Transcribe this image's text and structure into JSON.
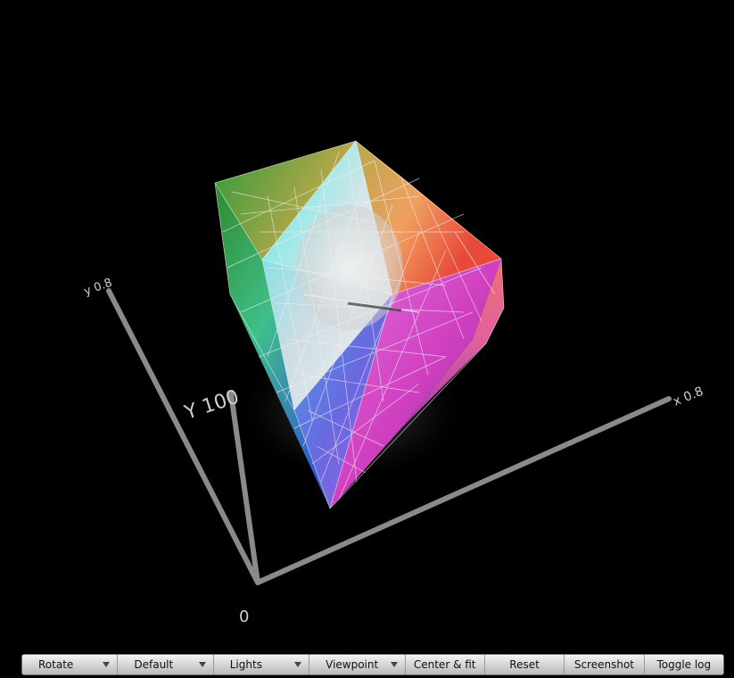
{
  "scene": {
    "axis_labels": {
      "y_top": "y 0.8",
      "x_right": "x 0.8",
      "Y_vertical": "Y 100",
      "origin": "0"
    }
  },
  "toolbar": {
    "buttons": [
      {
        "label": "Rotate",
        "menu": true
      },
      {
        "label": "Default",
        "menu": true
      },
      {
        "label": "Lights",
        "menu": true
      },
      {
        "label": "Viewpoint",
        "menu": true
      },
      {
        "label": "Center & fit",
        "menu": false
      },
      {
        "label": "Reset",
        "menu": false
      },
      {
        "label": "Screenshot",
        "menu": false
      },
      {
        "label": "Toggle log",
        "menu": false
      }
    ]
  }
}
